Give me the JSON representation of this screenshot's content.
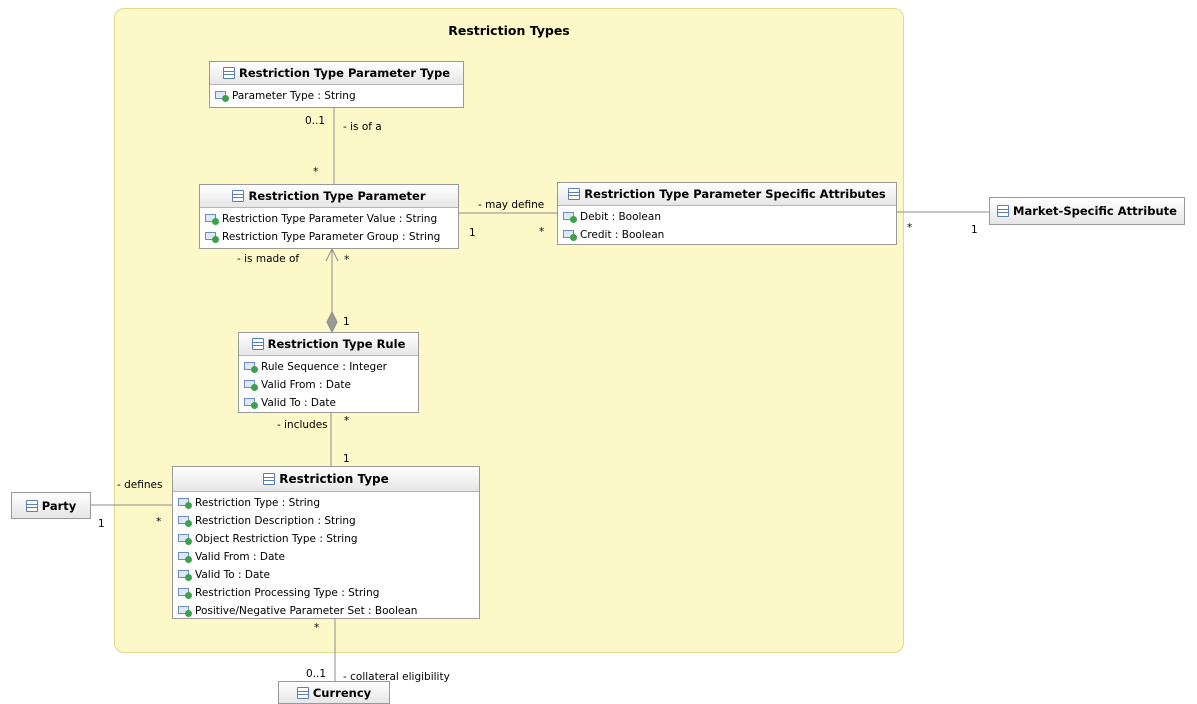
{
  "package": {
    "title": "Restriction Types"
  },
  "classes": {
    "rtpt": {
      "name": "Restriction Type Parameter Type",
      "attributes": [
        "Parameter Type : String"
      ]
    },
    "rtp": {
      "name": "Restriction Type Parameter",
      "attributes": [
        "Restriction Type Parameter Value : String",
        "Restriction Type Parameter Group : String"
      ]
    },
    "rtpsa": {
      "name": "Restriction Type Parameter Specific Attributes",
      "attributes": [
        "Debit : Boolean",
        "Credit : Boolean"
      ]
    },
    "msa": {
      "name": "Market-Specific Attribute"
    },
    "rtr": {
      "name": "Restriction Type Rule",
      "attributes": [
        "Rule Sequence : Integer",
        "Valid From : Date",
        "Valid To : Date"
      ]
    },
    "rt": {
      "name": "Restriction Type",
      "attributes": [
        "Restriction Type : String",
        "Restriction Description : String",
        "Object Restriction Type : String",
        "Valid From : Date",
        "Valid To : Date",
        "Restriction Processing Type : String",
        "Positive/Negative Parameter Set : Boolean"
      ]
    },
    "party": {
      "name": "Party"
    },
    "currency": {
      "name": "Currency"
    }
  },
  "associations": {
    "is_of_a": {
      "label": "- is of a",
      "mult_top": "0..1",
      "mult_bottom": "*"
    },
    "may_define": {
      "label": "- may define",
      "mult_left": "1",
      "mult_right": "*"
    },
    "msa_link": {
      "mult_left": "*",
      "mult_right": "1"
    },
    "is_made_of": {
      "label": "- is made of",
      "mult_top": "*",
      "mult_bottom": "1"
    },
    "includes": {
      "label": "- includes",
      "mult_top": "*",
      "mult_bottom": "1"
    },
    "defines": {
      "label": "- defines",
      "mult_left": "1",
      "mult_right": "*"
    },
    "collateral": {
      "label": "- collateral eligibility",
      "mult_top": "*",
      "mult_bottom": "0..1"
    }
  }
}
